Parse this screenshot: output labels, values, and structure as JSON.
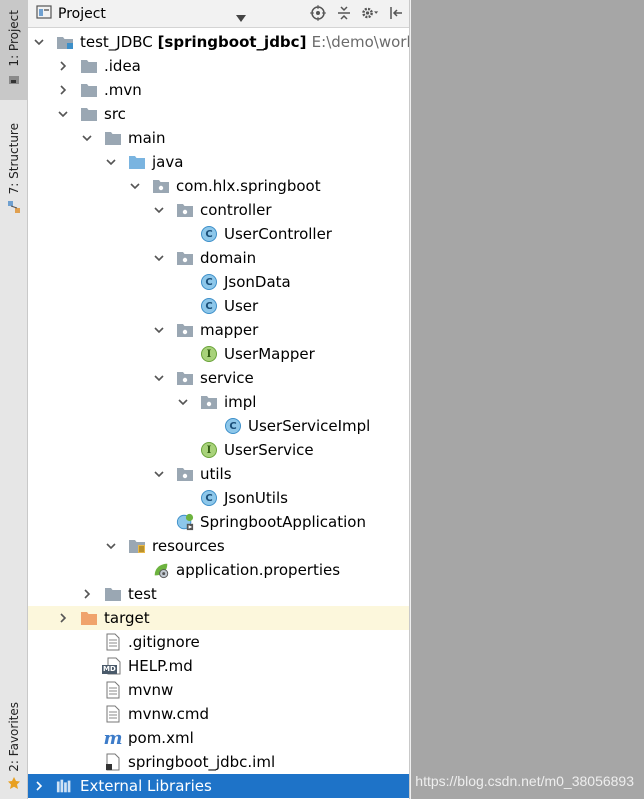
{
  "toolstrip": {
    "project_tab": "1: Project",
    "structure_tab": "7: Structure",
    "favorites_tab": "2: Favorites"
  },
  "header": {
    "title": "Project",
    "icons": [
      "project-panel-icon",
      "dropdown-icon",
      "locate-icon",
      "collapse-icon",
      "gear-icon",
      "hide-icon"
    ]
  },
  "tree": {
    "root_name": "test_JDBC",
    "root_module": "[springboot_jdbc]",
    "root_path": "E:\\demo\\worksp",
    "items": [
      {
        "label": "test_JDBC"
      },
      {
        "label": ".idea"
      },
      {
        "label": ".mvn"
      },
      {
        "label": "src"
      },
      {
        "label": "main"
      },
      {
        "label": "java"
      },
      {
        "label": "com.hlx.springboot"
      },
      {
        "label": "controller"
      },
      {
        "label": "UserController"
      },
      {
        "label": "domain"
      },
      {
        "label": "JsonData"
      },
      {
        "label": "User"
      },
      {
        "label": "mapper"
      },
      {
        "label": "UserMapper"
      },
      {
        "label": "service"
      },
      {
        "label": "impl"
      },
      {
        "label": "UserServiceImpl"
      },
      {
        "label": "UserService"
      },
      {
        "label": "utils"
      },
      {
        "label": "JsonUtils"
      },
      {
        "label": "SpringbootApplication"
      },
      {
        "label": "resources"
      },
      {
        "label": "application.properties"
      },
      {
        "label": "test"
      },
      {
        "label": "target"
      },
      {
        "label": ".gitignore"
      },
      {
        "label": "HELP.md"
      },
      {
        "label": "mvnw"
      },
      {
        "label": "mvnw.cmd"
      },
      {
        "label": "pom.xml"
      },
      {
        "label": "springboot_jdbc.iml"
      },
      {
        "label": "External Libraries"
      }
    ]
  },
  "icon_glyphs": {
    "class": "C",
    "interface": "I",
    "maven": "m",
    "md": "MD"
  },
  "watermark": "https://blog.csdn.net/m0_38056893",
  "colors": {
    "selection": "#1e73c8",
    "highlight_row": "#fcf7dc",
    "folder": "#9aa7b3",
    "excluded_folder": "#f0a36c",
    "class_icon": "#8dc7ea",
    "interface_icon": "#a8d27a"
  }
}
